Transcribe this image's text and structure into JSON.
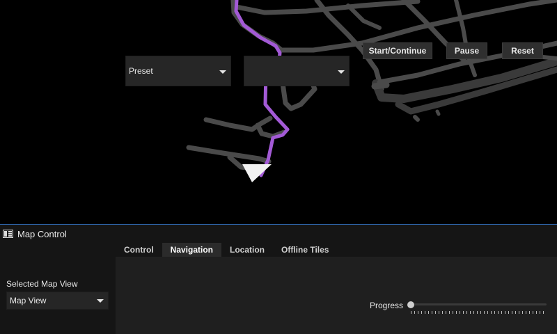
{
  "map": {
    "road_color": "#4a4a4a",
    "route_color": "#a35ad6",
    "background": "#000000"
  },
  "panel": {
    "title": "Map Control",
    "icon": "map-control-icon",
    "accent": "#2d63a8",
    "tabs": [
      {
        "label": "Control",
        "active": false
      },
      {
        "label": "Navigation",
        "active": true
      },
      {
        "label": "Location",
        "active": false
      },
      {
        "label": "Offline Tiles",
        "active": false
      }
    ],
    "selected_map_view": {
      "label": "Selected Map View",
      "value": "Map View"
    },
    "preset_combo": {
      "value": "Preset"
    },
    "secondary_combo": {
      "value": ""
    },
    "buttons": {
      "start": "Start/Continue",
      "pause": "Pause",
      "reset": "Reset"
    },
    "progress": {
      "label": "Progress",
      "value": 0
    }
  }
}
